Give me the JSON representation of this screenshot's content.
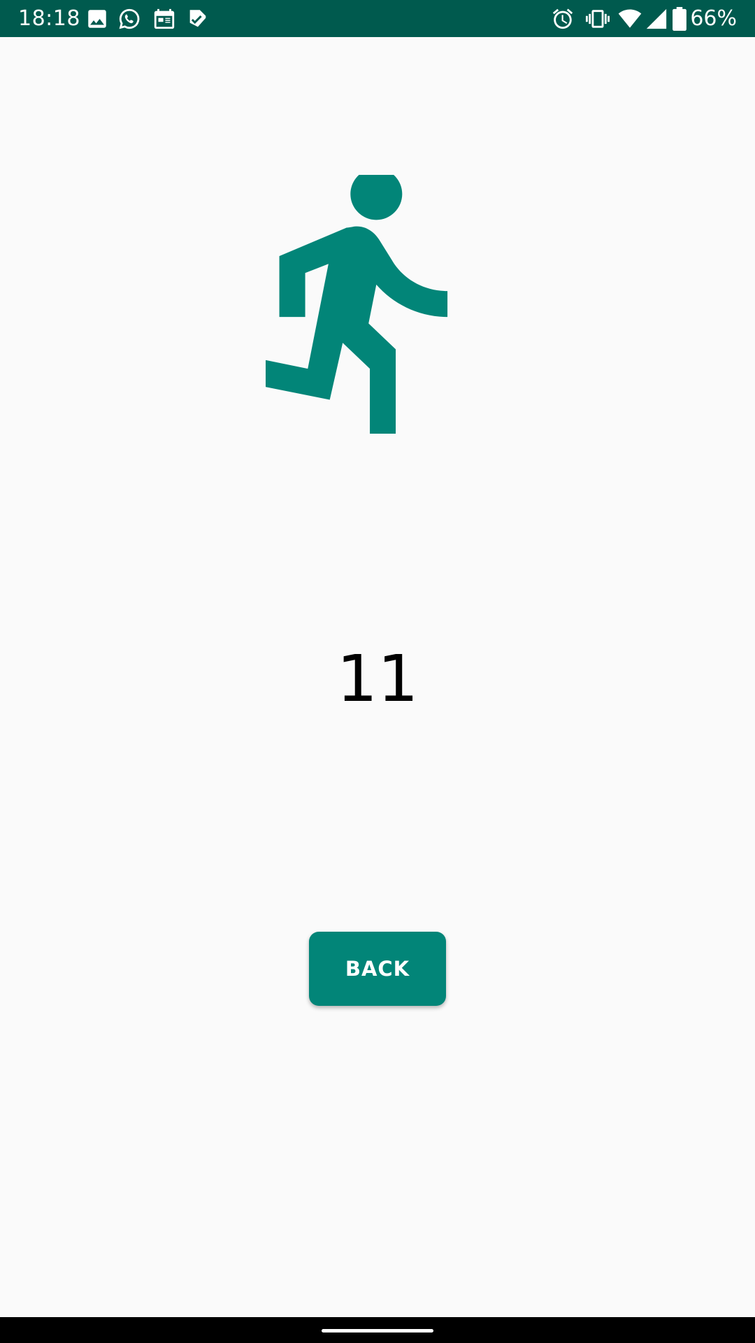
{
  "status_bar": {
    "time": "18:18",
    "battery_percent": "66%",
    "background_color": "#005a4e",
    "left_icons": [
      "image-icon",
      "whatsapp-icon",
      "calendar-icon",
      "check-app-icon"
    ],
    "right_icons": [
      "alarm-icon",
      "vibrate-icon",
      "wifi-icon",
      "signal-icon",
      "battery-icon"
    ]
  },
  "main": {
    "activity_icon": "running-person-icon",
    "accent_color": "#028578",
    "counter_value": "11",
    "back_label": "BACK"
  },
  "nav_bar": {
    "indicator": "home-indicator"
  }
}
